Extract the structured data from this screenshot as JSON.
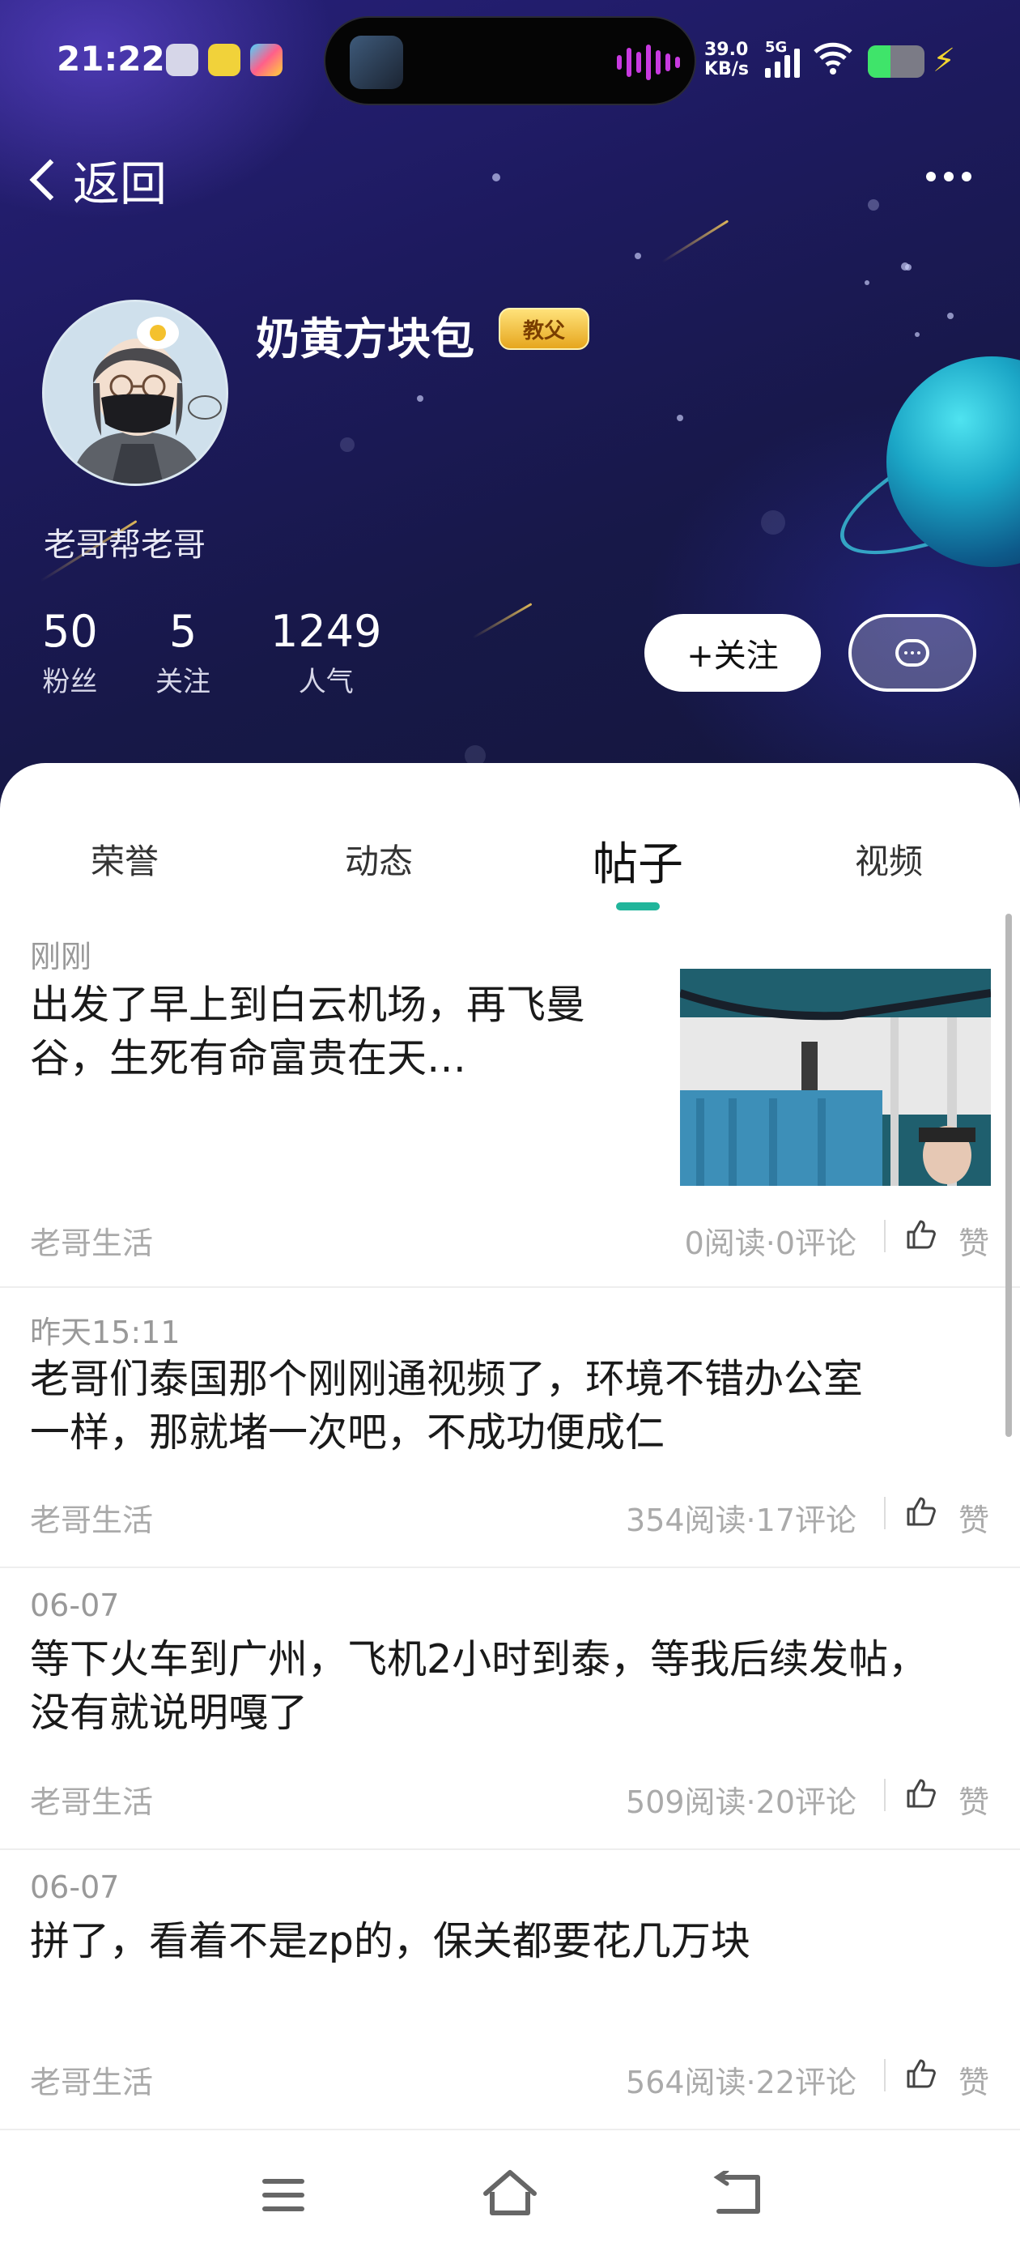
{
  "status_bar": {
    "time": "21:22",
    "net_speed_value": "39.0",
    "net_speed_unit": "KB/s",
    "network": "5G",
    "battery_level": 0.4,
    "icons": [
      "app-notification-icon",
      "app-notification-icon",
      "app-notification-icon",
      "wifi-icon",
      "battery-icon",
      "charging-bolt-icon"
    ]
  },
  "nav": {
    "back_label": "返回",
    "more_icon": "more-dots-icon"
  },
  "profile": {
    "name": "奶黄方块包",
    "badge": "教父",
    "bio": "老哥帮老哥",
    "stats": [
      {
        "value": "50",
        "label": "粉丝"
      },
      {
        "value": "5",
        "label": "关注"
      },
      {
        "value": "1249",
        "label": "人气"
      }
    ],
    "follow_label": "+关注",
    "message_icon": "chat-bubble-icon"
  },
  "tabs": [
    {
      "label": "荣誉",
      "active": false
    },
    {
      "label": "动态",
      "active": false
    },
    {
      "label": "帖子",
      "active": true
    },
    {
      "label": "视频",
      "active": false
    }
  ],
  "posts": [
    {
      "date": "刚刚",
      "title": "出发了早上到白云机场，再飞曼谷，生死有命富贵在天…",
      "title_lines": [
        "出发了早上到白云机场，再飞曼",
        "谷，生死有命富贵在天…"
      ],
      "category": "老哥生活",
      "stats": "0阅读·0评论",
      "like_label": "赞",
      "has_image": true
    },
    {
      "date": "昨天15:11",
      "title": "老哥们泰国那个刚刚通视频了，环境不错办公室一样，那就堵一次吧，不成功便成仁",
      "title_lines": [
        "老哥们泰国那个刚刚通视频了，环境不错办公室",
        "一样，那就堵一次吧，不成功便成仁"
      ],
      "category": "老哥生活",
      "stats": "354阅读·17评论",
      "like_label": "赞"
    },
    {
      "date": "06-07",
      "title": "等下火车到广州，飞机2小时到泰，等我后续发帖，没有就说明嘎了",
      "title_lines": [
        "等下火车到广州，飞机2小时到泰，等我后续发帖，",
        "没有就说明嘎了"
      ],
      "category": "老哥生活",
      "stats": "509阅读·20评论",
      "like_label": "赞"
    },
    {
      "date": "06-07",
      "title": "拼了，看着不是zp的，保关都要花几万块",
      "title_lines": [
        "拼了，看着不是zp的，保关都要花几万块"
      ],
      "category": "老哥生活",
      "stats": "564阅读·22评论",
      "like_label": "赞"
    }
  ],
  "bottom_nav": {
    "icons": [
      "menu-icon",
      "home-icon",
      "back-nav-icon"
    ]
  },
  "colors": {
    "accent": "#21b59b",
    "hero_bg": "#1d1a5e",
    "badge": "#e6a61e"
  }
}
